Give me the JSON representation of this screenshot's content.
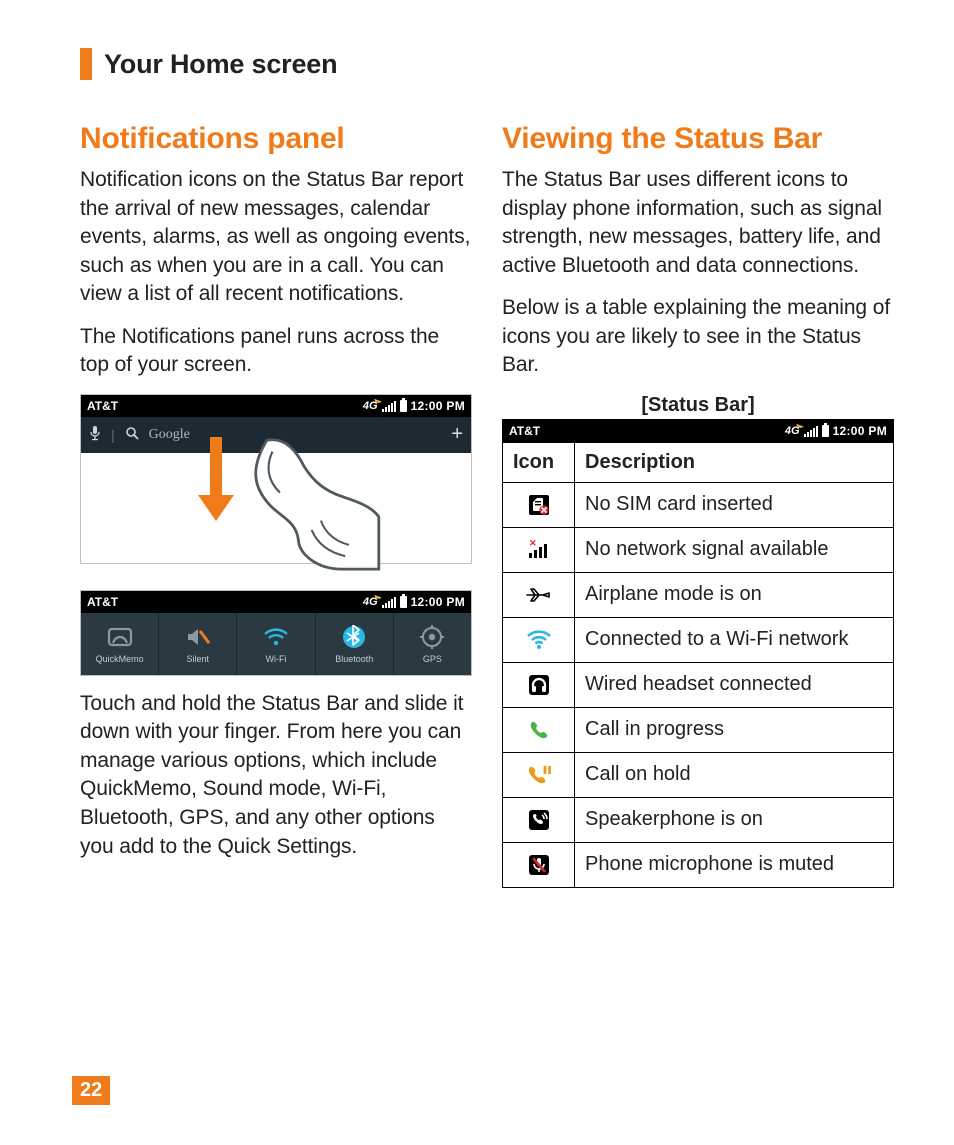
{
  "section_title": "Your Home screen",
  "page_number": "22",
  "left": {
    "heading": "Notifications panel",
    "p1": "Notification icons on the Status Bar report the arrival of new messages, calendar events, alarms, as well as ongoing events, such as when you are in a call. You can view a list of all recent notifications.",
    "p2": "The Notifications panel runs across the top of your screen.",
    "status": {
      "carrier": "AT&T",
      "net": "4G",
      "time": "12:00 PM"
    },
    "search": {
      "mic": "🎤",
      "glass": "🔍",
      "placeholder": "Google",
      "plus": "+"
    },
    "quick_settings": [
      {
        "key": "quickmemo",
        "label": "QuickMemo"
      },
      {
        "key": "silent",
        "label": "Silent"
      },
      {
        "key": "wifi",
        "label": "Wi-Fi"
      },
      {
        "key": "bluetooth",
        "label": "Bluetooth"
      },
      {
        "key": "gps",
        "label": "GPS"
      }
    ],
    "p3": "Touch and hold the Status Bar and slide it down with your finger. From here you can manage various options, which include QuickMemo, Sound mode, Wi-Fi, Bluetooth, GPS, and any other options you add to the Quick Settings."
  },
  "right": {
    "heading": "Viewing the Status Bar",
    "p1": "The Status Bar uses different icons to display phone information, such as signal strength, new messages, battery life, and active Bluetooth and data connections.",
    "p2": "Below is a table explaining the meaning of icons you are likely to see in the Status Bar.",
    "caption": "[Status Bar]",
    "status": {
      "carrier": "AT&T",
      "net": "4G",
      "time": "12:00 PM"
    },
    "table": {
      "h_icon": "Icon",
      "h_desc": "Description",
      "rows": [
        {
          "icon": "no-sim",
          "desc": "No SIM card inserted"
        },
        {
          "icon": "no-signal",
          "desc": "No network signal available"
        },
        {
          "icon": "airplane",
          "desc": "Airplane mode is on"
        },
        {
          "icon": "wifi",
          "desc": "Connected to a Wi-Fi network"
        },
        {
          "icon": "headset",
          "desc": "Wired headset connected"
        },
        {
          "icon": "call",
          "desc": "Call in progress"
        },
        {
          "icon": "call-hold",
          "desc": "Call on hold"
        },
        {
          "icon": "speaker",
          "desc": "Speakerphone is on"
        },
        {
          "icon": "mic-mute",
          "desc": "Phone microphone is muted"
        }
      ]
    }
  }
}
